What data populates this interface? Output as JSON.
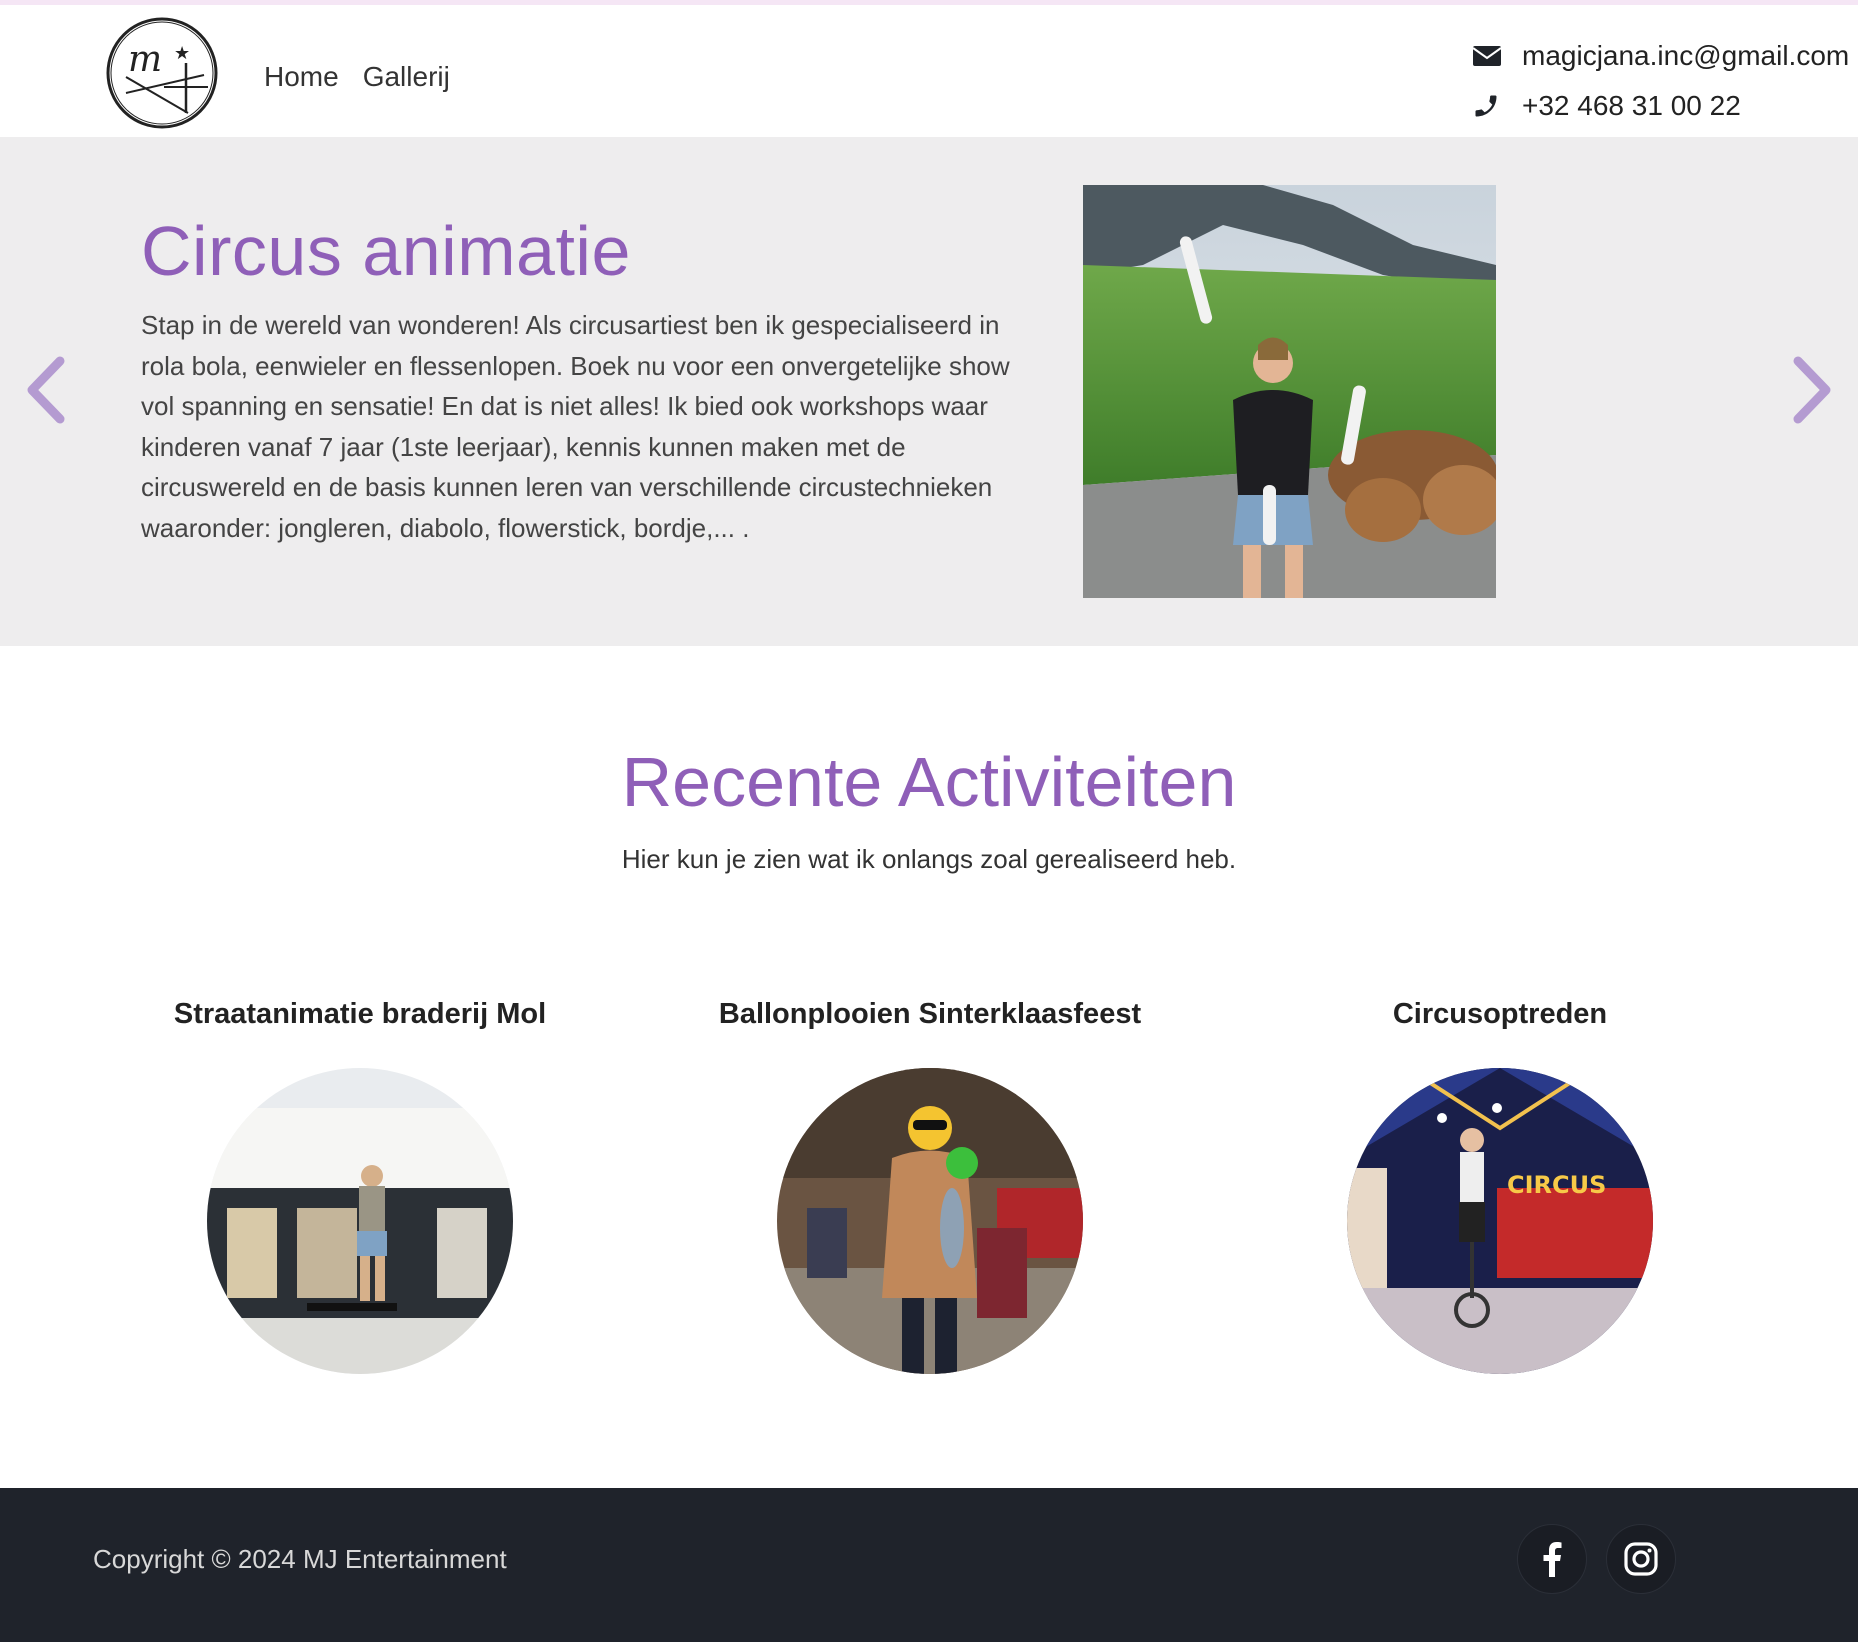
{
  "header": {
    "logo_alt": "MJ",
    "nav": [
      {
        "label": "Home"
      },
      {
        "label": "Gallerij"
      }
    ],
    "contact": {
      "email": "magicjana.inc@gmail.com",
      "phone": "+32 468 31 00 22"
    }
  },
  "hero": {
    "title": "Circus animatie",
    "text": "Stap in de wereld van wonderen! Als circusartiest ben ik gespecialiseerd in rola bola, eenwieler en flessenlopen. Boek nu voor een onvergetelijke show vol spanning en sensatie! En dat is niet alles! Ik bied ook workshops waar kinderen vanaf 7 jaar (1ste leerjaar), kennis kunnen maken met de circuswereld en de basis kunnen leren van verschillende circustechnieken waaronder: jongleren, diabolo, flowerstick, bordje,... ."
  },
  "recent": {
    "title": "Recente Activiteiten",
    "subtitle": "Hier kun je zien wat ik onlangs zoal gerealiseerd heb.",
    "items": [
      {
        "title": "Straatanimatie braderij Mol"
      },
      {
        "title": "Ballonplooien Sinterklaasfeest"
      },
      {
        "title": "Circusoptreden"
      }
    ]
  },
  "footer": {
    "copyright": "Copyright © 2024 MJ Entertainment"
  },
  "colors": {
    "accent": "#8f5fb8",
    "arrow": "#b49bd1",
    "hero_bg": "#eeedee",
    "footer_bg": "#1f232b"
  },
  "icons": {
    "email": "envelope-icon",
    "phone": "phone-icon",
    "prev": "chevron-left-icon",
    "next": "chevron-right-icon",
    "facebook": "facebook-icon",
    "instagram": "instagram-icon"
  }
}
